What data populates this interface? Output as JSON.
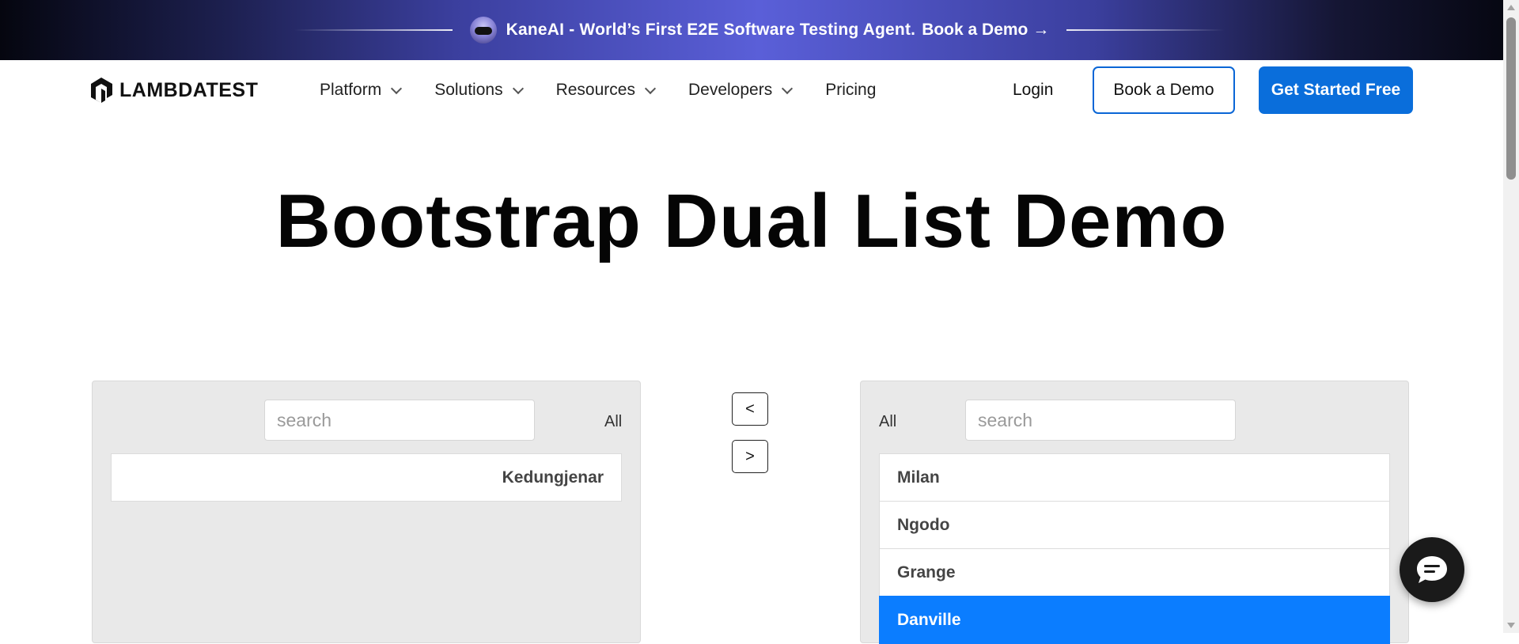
{
  "banner": {
    "text": "KaneAI - World’s First E2E Software Testing Agent.",
    "link_label": "Book a Demo",
    "arrow": "→",
    "avatar_icon": "kaneai-avatar-icon"
  },
  "nav": {
    "logo_text": "LAMBDATEST",
    "menu": [
      {
        "label": "Platform",
        "has_dropdown": true
      },
      {
        "label": "Solutions",
        "has_dropdown": true
      },
      {
        "label": "Resources",
        "has_dropdown": true
      },
      {
        "label": "Developers",
        "has_dropdown": true
      },
      {
        "label": "Pricing",
        "has_dropdown": false
      }
    ],
    "login_label": "Login",
    "book_demo_label": "Book a Demo",
    "get_started_label": "Get Started Free"
  },
  "page": {
    "title": "Bootstrap Dual List Demo"
  },
  "dual_list": {
    "left": {
      "search_placeholder": "search",
      "all_label": "All",
      "items": [
        "Kedungjenar"
      ]
    },
    "right": {
      "search_placeholder": "search",
      "all_label": "All",
      "items": [
        "Milan",
        "Ngodo",
        "Grange",
        "Danville"
      ],
      "selected_item": "Danville"
    },
    "move_left_label": "<",
    "move_right_label": ">"
  },
  "colors": {
    "accent": "#0a6edb",
    "selected_item_bg": "#0b7dff",
    "panel_bg": "#e9e9e9"
  },
  "chat": {
    "icon": "chat-icon"
  }
}
